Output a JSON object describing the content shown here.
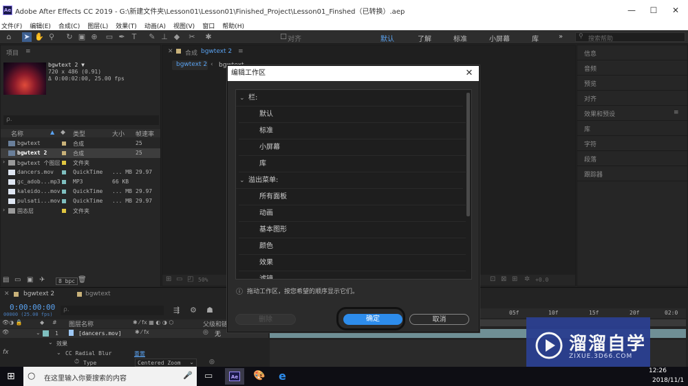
{
  "window": {
    "title": "Adobe After Effects CC 2019 - G:\\新建文件夹\\Lesson01\\Lesson01\\Finished_Project\\Lesson01_Finshed（已转换）.aep",
    "logo": "Ae",
    "minimize": "—",
    "maximize": "☐",
    "close": "✕"
  },
  "menu": [
    "文件(F)",
    "编辑(E)",
    "合成(C)",
    "图层(L)",
    "效果(T)",
    "动画(A)",
    "视图(V)",
    "窗口",
    "帮助(H)"
  ],
  "toolbar": {
    "snap_label": "对齐",
    "workspaces": [
      "默认",
      "了解",
      "标准",
      "小屏幕",
      "库"
    ],
    "more": "»",
    "search_placeholder": "搜索帮助"
  },
  "project": {
    "tab": "项目",
    "selected_name": "bgwtext 2 ▼",
    "selected_dims": "720 x 486 (0.91)",
    "selected_duration": "Δ 0:00:02:00, 25.00 fps",
    "search_placeholder": "ρ.",
    "columns": {
      "name": "名称",
      "type": "类型",
      "size": "大小",
      "fps": "帧速率"
    },
    "rows": [
      {
        "name": "bgwtext",
        "type": "合成",
        "size": "",
        "fps": "25",
        "color": "#c9b27a"
      },
      {
        "name": "bgwtext 2",
        "type": "合成",
        "size": "",
        "fps": "25",
        "color": "#c9b27a"
      },
      {
        "name": "bgwtext 个图层",
        "type": "文件夹",
        "size": "",
        "fps": "",
        "color": "#e0c640"
      },
      {
        "name": "dancers.mov",
        "type": "QuickTime",
        "size": "... MB",
        "fps": "29.97",
        "color": "#7fbfbf"
      },
      {
        "name": "gc_adob...mp3",
        "type": "MP3",
        "size": "66 KB",
        "fps": "",
        "color": "#7fbfbf"
      },
      {
        "name": "kaleido...mov",
        "type": "QuickTime",
        "size": "... MB",
        "fps": "29.97",
        "color": "#7fbfbf"
      },
      {
        "name": "pulsati...mov",
        "type": "QuickTime",
        "size": "... MB",
        "fps": "29.97",
        "color": "#7fbfbf"
      },
      {
        "name": "固态层",
        "type": "文件夹",
        "size": "",
        "fps": "",
        "color": "#e0c640"
      }
    ],
    "bpc": "8 bpc"
  },
  "composition": {
    "tab": "合成",
    "tab_name": "bgwtext 2",
    "crumb1": "bgwtext 2",
    "crumb2": "bgwtext",
    "zoom": "50%",
    "exposure": "+0.0"
  },
  "right_panels": [
    "信息",
    "音频",
    "预览",
    "对齐",
    "效果和预设",
    "库",
    "字符",
    "段落",
    "跟踪器"
  ],
  "timeline": {
    "tab1": "bgwtext 2",
    "tab2": "bgwtext",
    "timecode": "0:00:00:00",
    "frame_info": "00000 (25.00 fps)",
    "search_placeholder": "ρ.",
    "col_layer_name": "图层名称",
    "col_parent": "父级和链接",
    "layer_num": "1",
    "layer_name": "[dancers.mov]",
    "parent_value": "无",
    "effects_label": "效果",
    "effect_name": "CC Radial Blur",
    "reset": "重置",
    "prop_type": "Type",
    "prop_value": "Centered Zoom",
    "fx": "fx",
    "ruler": [
      "05f",
      "10f",
      "15f",
      "20f",
      "02:0"
    ]
  },
  "dialog": {
    "title": "编辑工作区",
    "close": "✕",
    "groups": [
      {
        "label": "栏:",
        "items": [
          "默认",
          "标准",
          "小屏幕",
          "库"
        ]
      },
      {
        "label": "溢出菜单:",
        "items": [
          "所有面板",
          "动画",
          "基本图形",
          "颜色",
          "效果",
          "滤镜"
        ]
      }
    ],
    "hint": "拖动工作区，按您希望的顺序显示它们。",
    "delete_label": "删除",
    "ok_label": "确定",
    "cancel_label": "取消"
  },
  "taskbar": {
    "search_placeholder": "在这里输入你要搜索的内容",
    "time": "12:26",
    "date": "2018/11/1"
  },
  "watermark": {
    "brand": "溜溜自学",
    "url": "ZIXUE.3D66.COM"
  },
  "colors": {
    "accent": "#2d8ceb",
    "dialog_bg": "#2b2b2b",
    "watermark_bg": "#2b3f8f"
  }
}
